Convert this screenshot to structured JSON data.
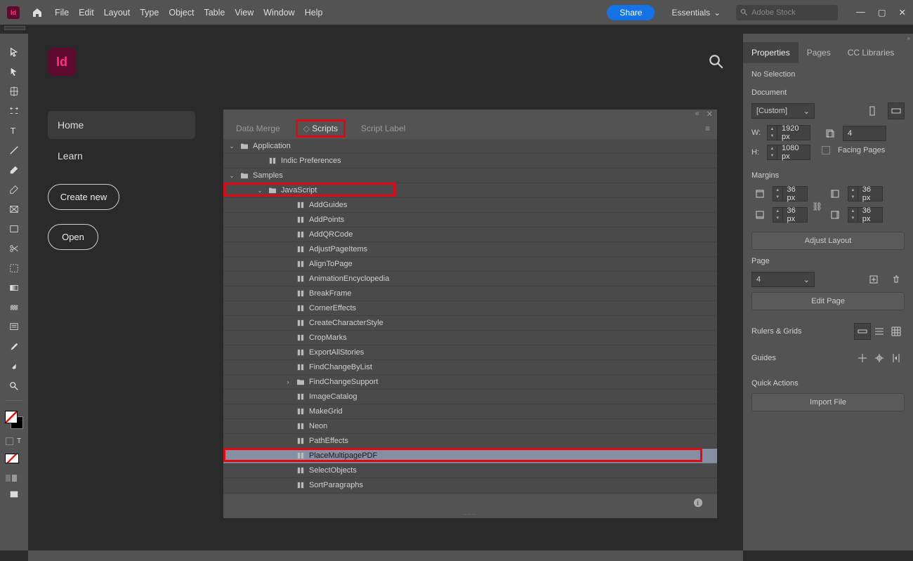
{
  "menubar": {
    "items": [
      "File",
      "Edit",
      "Layout",
      "Type",
      "Object",
      "Table",
      "View",
      "Window",
      "Help"
    ],
    "share": "Share",
    "workspace": "Essentials",
    "stock_placeholder": "Adobe Stock"
  },
  "home": {
    "nav": [
      "Home",
      "Learn"
    ],
    "create": "Create new",
    "open": "Open"
  },
  "scripts_panel": {
    "tabs": [
      "Data Merge",
      "Scripts",
      "Script Label"
    ],
    "active_tab": 1,
    "tree": [
      {
        "indent": 0,
        "arrow": "down",
        "type": "folder",
        "label": "Application"
      },
      {
        "indent": 1,
        "arrow": "",
        "type": "script",
        "label": "Indic Preferences"
      },
      {
        "indent": 0,
        "arrow": "down",
        "type": "folder",
        "label": "Samples"
      },
      {
        "indent": 1,
        "arrow": "down",
        "type": "folder",
        "label": "JavaScript",
        "highlight": true
      },
      {
        "indent": 2,
        "arrow": "",
        "type": "script",
        "label": "AddGuides"
      },
      {
        "indent": 2,
        "arrow": "",
        "type": "script",
        "label": "AddPoints"
      },
      {
        "indent": 2,
        "arrow": "",
        "type": "script",
        "label": "AddQRCode"
      },
      {
        "indent": 2,
        "arrow": "",
        "type": "script",
        "label": "AdjustPageItems"
      },
      {
        "indent": 2,
        "arrow": "",
        "type": "script",
        "label": "AlignToPage"
      },
      {
        "indent": 2,
        "arrow": "",
        "type": "script",
        "label": "AnimationEncyclopedia"
      },
      {
        "indent": 2,
        "arrow": "",
        "type": "script",
        "label": "BreakFrame"
      },
      {
        "indent": 2,
        "arrow": "",
        "type": "script",
        "label": "CornerEffects"
      },
      {
        "indent": 2,
        "arrow": "",
        "type": "script",
        "label": "CreateCharacterStyle"
      },
      {
        "indent": 2,
        "arrow": "",
        "type": "script",
        "label": "CropMarks"
      },
      {
        "indent": 2,
        "arrow": "",
        "type": "script",
        "label": "ExportAllStories"
      },
      {
        "indent": 2,
        "arrow": "",
        "type": "script",
        "label": "FindChangeByList"
      },
      {
        "indent": 2,
        "arrow": "right",
        "type": "folder",
        "label": "FindChangeSupport"
      },
      {
        "indent": 2,
        "arrow": "",
        "type": "script",
        "label": "ImageCatalog"
      },
      {
        "indent": 2,
        "arrow": "",
        "type": "script",
        "label": "MakeGrid"
      },
      {
        "indent": 2,
        "arrow": "",
        "type": "script",
        "label": "Neon"
      },
      {
        "indent": 2,
        "arrow": "",
        "type": "script",
        "label": "PathEffects"
      },
      {
        "indent": 2,
        "arrow": "",
        "type": "script",
        "label": "PlaceMultipagePDF",
        "selected": true,
        "highlight": true
      },
      {
        "indent": 2,
        "arrow": "",
        "type": "script",
        "label": "SelectObjects"
      },
      {
        "indent": 2,
        "arrow": "",
        "type": "script",
        "label": "SortParagraphs"
      }
    ]
  },
  "properties": {
    "tabs": [
      "Properties",
      "Pages",
      "CC Libraries"
    ],
    "no_selection": "No Selection",
    "document": "Document",
    "preset": "[Custom]",
    "w_label": "W:",
    "h_label": "H:",
    "w": "1920 px",
    "h": "1080 px",
    "pages_icon_val": "4",
    "facing": "Facing Pages",
    "margins": "Margins",
    "m_top": "36 px",
    "m_bottom": "36 px",
    "m_left": "36 px",
    "m_right": "36 px",
    "adjust": "Adjust Layout",
    "page": "Page",
    "page_val": "4",
    "edit_page": "Edit Page",
    "rulers": "Rulers & Grids",
    "guides": "Guides",
    "quick": "Quick Actions",
    "import": "Import File"
  }
}
